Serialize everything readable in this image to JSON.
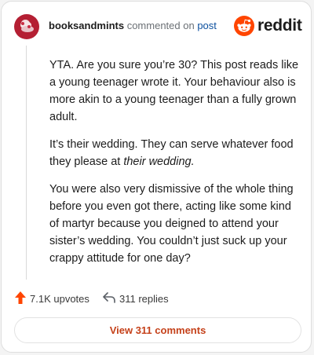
{
  "header": {
    "username": "booksandmints",
    "action": "commented on",
    "link": "post",
    "brand": "reddit"
  },
  "comment": {
    "p1": "YTA. Are you sure you’re 30? This post reads like a young teenager wrote it. Your behaviour also is more akin to a young teenager than a fully grown adult.",
    "p2_before": "It’s their wedding. They can serve whatever food they please at ",
    "p2_em": "their wedding.",
    "p3": "You were also very dismissive of the whole thing before you even got there, acting like some kind of martyr because you deigned to attend your sister’s wedding. You couldn’t just suck up your crappy attitude for one day?"
  },
  "actions": {
    "upvotes": "7.1K upvotes",
    "replies": "311 replies",
    "view_comments": "View 311 comments"
  },
  "colors": {
    "brand_orange": "#ff4500",
    "upvote": "#ff4500",
    "link": "#0b4f9e",
    "button_text": "#c5411a"
  }
}
